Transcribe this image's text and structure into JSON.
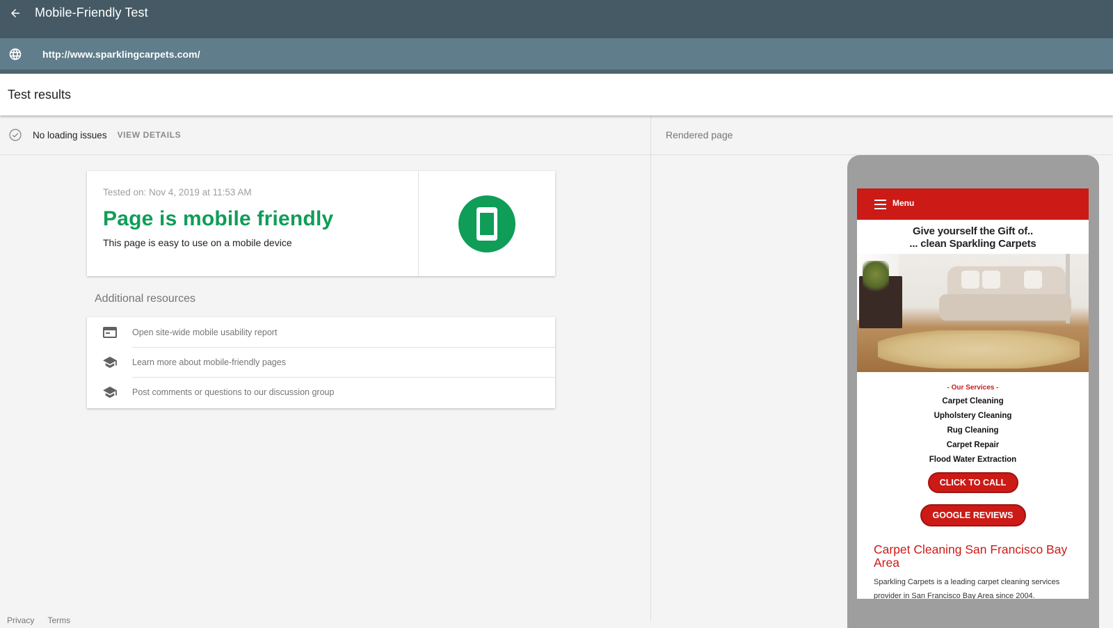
{
  "appbar": {
    "title": "Mobile-Friendly Test"
  },
  "urlbar": {
    "url": "http://www.sparklingcarpets.com/"
  },
  "results": {
    "title": "Test results",
    "status_label": "No loading issues",
    "view_details": "VIEW DETAILS",
    "rendered_label": "Rendered page"
  },
  "summary": {
    "tested_on": "Tested on: Nov 4, 2019 at 11:53 AM",
    "headline": "Page is mobile friendly",
    "subtext": "This page is easy to use on a mobile device",
    "accent_color": "#0f9d58"
  },
  "resources": {
    "title": "Additional resources",
    "items": [
      {
        "icon": "web-report-icon",
        "label": "Open site-wide mobile usability report"
      },
      {
        "icon": "school-icon",
        "label": "Learn more about mobile-friendly pages"
      },
      {
        "icon": "school-icon",
        "label": "Post comments or questions to our discussion group"
      }
    ]
  },
  "footer": {
    "privacy": "Privacy",
    "terms": "Terms"
  },
  "rendered_site": {
    "menu_label": "Menu",
    "tagline_1": "Give yourself the Gift of..",
    "tagline_2": "... clean Sparkling Carpets",
    "services_title": "- Our Services -",
    "services": [
      "Carpet Cleaning",
      "Upholstery Cleaning",
      "Rug Cleaning",
      "Carpet Repair",
      "Flood Water Extraction"
    ],
    "call_button": "CLICK TO CALL",
    "reviews_button": "GOOGLE REVIEWS",
    "heading": "Carpet Cleaning San Francisco Bay Area",
    "paragraph": "Sparkling Carpets is a leading carpet cleaning services provider in San Francisco Bay Area since 2004.",
    "brand_color": "#cc1a16"
  }
}
